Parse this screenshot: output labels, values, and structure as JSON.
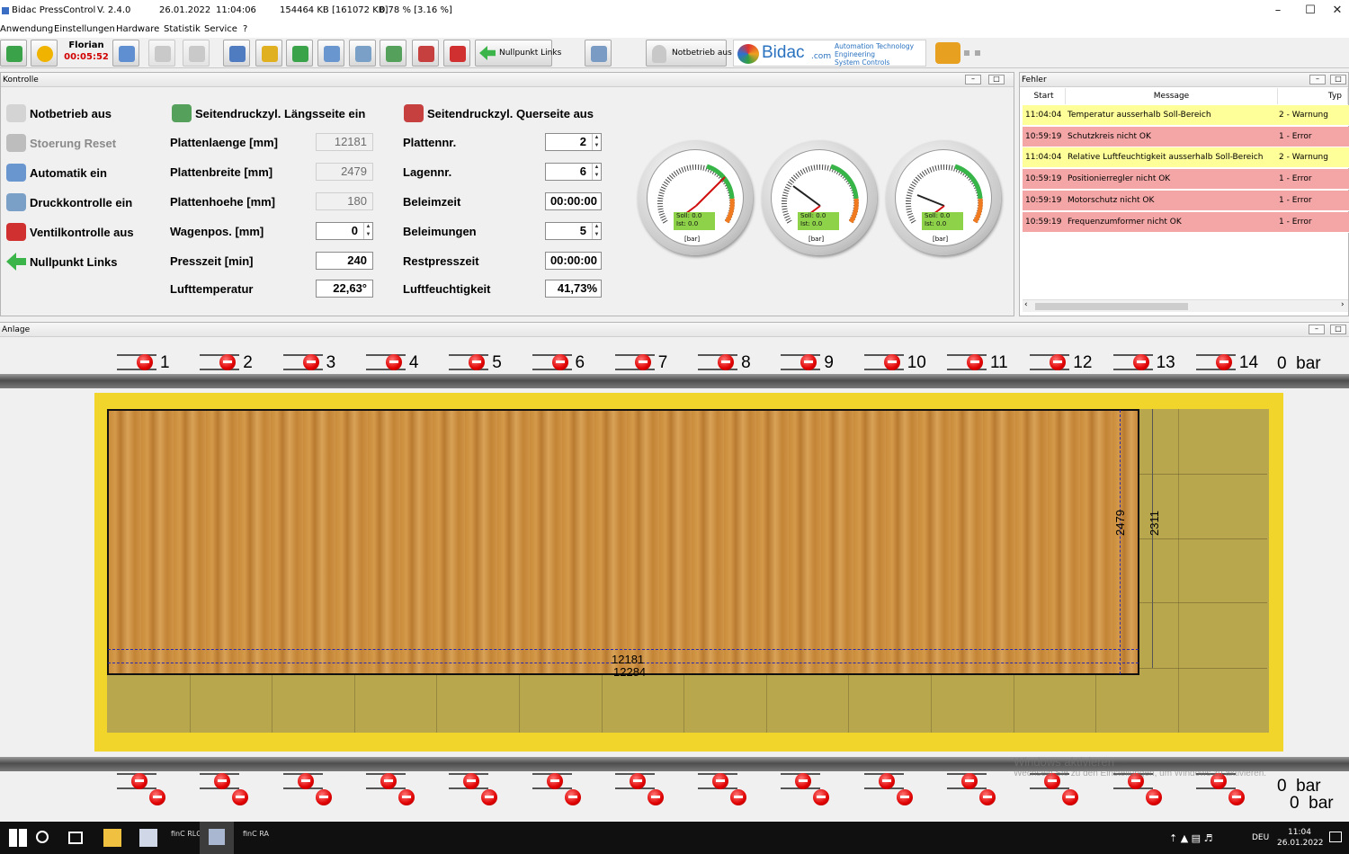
{
  "titlebar": {
    "app": "Bidac PressControl",
    "version": "V. 2.4.0",
    "date": "26.01.2022",
    "time": "11:04:06",
    "memory": "154464 KB [161072 KB]",
    "cpu": "0.78 % [3.16 %]"
  },
  "menu": [
    "Anwendung",
    "Einstellungen",
    "Hardware",
    "Statistik",
    "Service",
    "?"
  ],
  "toolbar": {
    "user": "Florian",
    "timer": "00:05:52",
    "nullpunkt_label": "Nullpunkt Links",
    "notbetrieb_label": "Notbetrieb aus",
    "brand": "Bidac",
    "brand_suffix": ".com",
    "brand_lines": [
      "Automation Technology",
      "Engineering",
      "System Controls"
    ]
  },
  "kontrolle": {
    "title": "Kontrolle",
    "actions": [
      "Notbetrieb aus",
      "Stoerung Reset",
      "Automatik ein",
      "Druckkontrolle ein",
      "Ventilkontrolle aus",
      "Nullpunkt Links"
    ],
    "col2_header": "Seitendruckzyl. Längsseite ein",
    "col3_header": "Seitendruckzyl. Querseite aus",
    "fields_left": [
      {
        "label": "Plattenlaenge [mm]",
        "value": "12181"
      },
      {
        "label": "Plattenbreite [mm]",
        "value": "2479"
      },
      {
        "label": "Plattenhoehe [mm]",
        "value": "180"
      },
      {
        "label": "Wagenpos. [mm]",
        "value": "0"
      },
      {
        "label": "Presszeit [min]",
        "value": "240"
      },
      {
        "label": "Lufttemperatur",
        "value": "22,63°"
      }
    ],
    "fields_right": [
      {
        "label": "Plattennr.",
        "value": "2"
      },
      {
        "label": "Lagennr.",
        "value": "6"
      },
      {
        "label": "Beleimzeit",
        "value": "00:00:00"
      },
      {
        "label": "Beleimungen",
        "value": "5"
      },
      {
        "label": "Restpresszeit",
        "value": "00:00:00"
      },
      {
        "label": "Luftfeuchtigkeit",
        "value": "41,73%"
      }
    ],
    "gauges": [
      {
        "soll": "Soll: 0.0",
        "ist": "Ist: 0.0",
        "unit": "[bar]"
      },
      {
        "soll": "Soll: 0.0",
        "ist": "Ist: 0.0",
        "unit": "[bar]"
      },
      {
        "soll": "Soll: 0.0",
        "ist": "Ist: 0.0",
        "unit": "[bar]"
      }
    ]
  },
  "fehler": {
    "title": "Fehler",
    "columns": [
      "Start",
      "Message",
      "Typ"
    ],
    "rows": [
      {
        "start": "11:04:04",
        "message": "Temperatur ausserhalb Soll-Bereich",
        "typ": "2 - Warnung",
        "color": "#ffff99"
      },
      {
        "start": "10:59:19",
        "message": "Schutzkreis nicht OK",
        "typ": "1 - Error",
        "color": "#f4a6a6"
      },
      {
        "start": "11:04:04",
        "message": "Relative Luftfeuchtigkeit ausserhalb Soll-Bereich",
        "typ": "2 - Warnung",
        "color": "#ffff99"
      },
      {
        "start": "10:59:19",
        "message": "Positionierregler nicht OK",
        "typ": "1 - Error",
        "color": "#f4a6a6"
      },
      {
        "start": "10:59:19",
        "message": "Motorschutz nicht OK",
        "typ": "1 - Error",
        "color": "#f4a6a6"
      },
      {
        "start": "10:59:19",
        "message": "Frequenzumformer nicht OK",
        "typ": "1 - Error",
        "color": "#f4a6a6"
      }
    ]
  },
  "anlage": {
    "title": "Anlage",
    "cylinders": [
      "1",
      "2",
      "3",
      "4",
      "5",
      "6",
      "7",
      "8",
      "9",
      "10",
      "11",
      "12",
      "13",
      "14"
    ],
    "top_pressure": "0  bar",
    "bottom_pressure_1": "0  bar",
    "bottom_pressure_2": "0  bar",
    "dim_length_inner": "12181",
    "dim_length_outer": "12284",
    "dim_width_inner": "2479",
    "dim_width_outer": "2311"
  },
  "watermark": {
    "line1": "Windows aktivieren",
    "line2": "Wechseln Sie zu den Einstellungen, um Windows zu aktivieren."
  },
  "taskbar": {
    "lang": "DEU",
    "time": "11:04",
    "date": "26.01.2022",
    "app1": "finC RLG",
    "app2": "finC RA"
  }
}
